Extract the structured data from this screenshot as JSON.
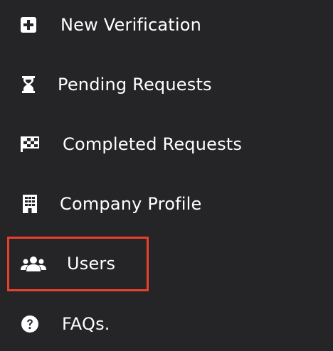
{
  "menu": {
    "items": [
      {
        "label": "New Verification",
        "icon": "plus-square-icon"
      },
      {
        "label": "Pending Requests",
        "icon": "hourglass-icon"
      },
      {
        "label": "Completed Requests",
        "icon": "checkered-flag-icon"
      },
      {
        "label": "Company Profile",
        "icon": "building-icon"
      },
      {
        "label": "Users",
        "icon": "users-icon"
      },
      {
        "label": "FAQs.",
        "icon": "question-circle-icon"
      }
    ]
  },
  "colors": {
    "background": "#252528",
    "text": "#ffffff",
    "highlight_border": "#e8402a"
  }
}
